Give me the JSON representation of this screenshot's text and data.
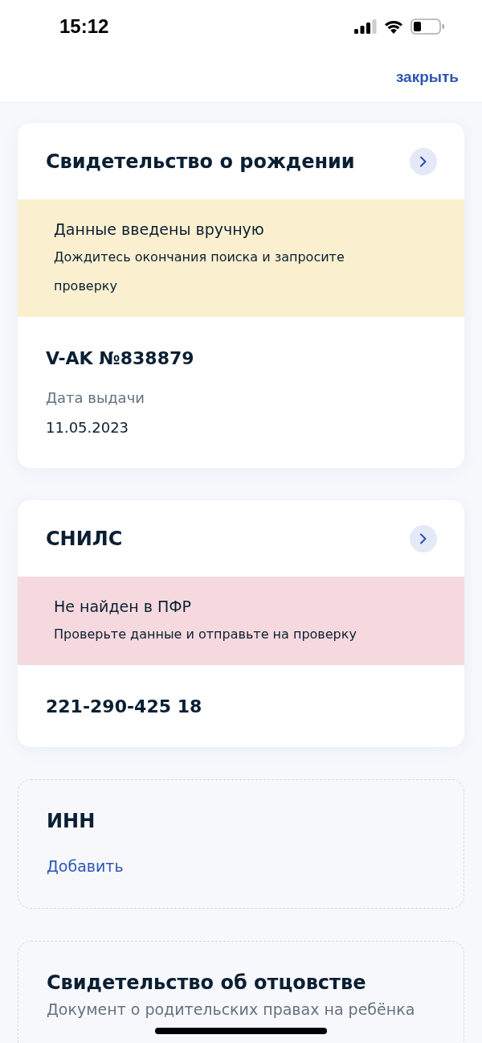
{
  "status_bar": {
    "time": "15:12"
  },
  "header": {
    "close_link": "закрыть"
  },
  "documents": [
    {
      "kind": "card",
      "title": "Свидетельство о рождении",
      "alert": {
        "color": "#faefcf",
        "title": "Данные введены вручную",
        "text": "Дождитесь окончания поиска и запросите проверку"
      },
      "number": "V-AK №838879",
      "fields": [
        {
          "label": "Дата выдачи",
          "value": "11.05.2023"
        }
      ]
    },
    {
      "kind": "card",
      "title": "СНИЛС",
      "alert": {
        "color": "#f6d9de",
        "title": "Не найден в ПФР",
        "text": "Проверьте данные и отправьте на проверку"
      },
      "number": "221-290-425 18"
    },
    {
      "kind": "empty",
      "title": "ИНН",
      "add_link": "Добавить"
    },
    {
      "kind": "empty",
      "title": "Свидетельство об отцовстве",
      "description": "Документ о родительских правах на ребёнка"
    }
  ]
}
